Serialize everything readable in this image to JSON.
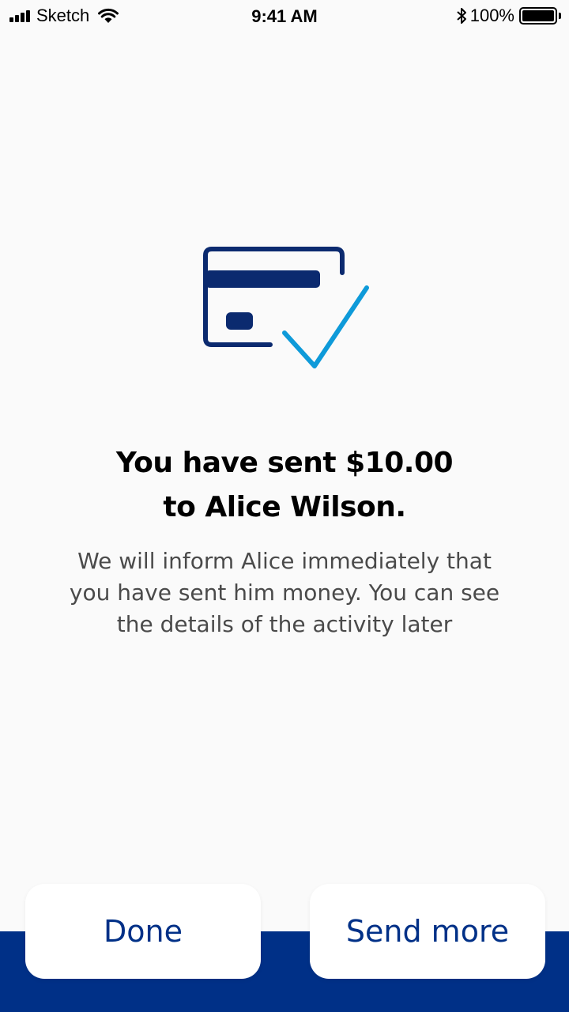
{
  "status_bar": {
    "carrier": "Sketch",
    "time": "9:41 AM",
    "battery_percent": "100%",
    "icons": [
      "signal-icon",
      "wifi-icon",
      "bluetooth-icon",
      "battery-icon"
    ]
  },
  "illustration": {
    "icon": "card-check-icon",
    "colors": {
      "card": "#0b2a6f",
      "check": "#0e9ad9"
    }
  },
  "confirmation": {
    "title_line1": "You have sent $10.00",
    "title_line2": "to Alice Wilson.",
    "message_line1": "We will inform Alice immediately that",
    "message_line2": "you have sent him money. You can see",
    "message_line3": "the details of the activity later"
  },
  "actions": {
    "done_label": "Done",
    "send_more_label": "Send more"
  },
  "colors": {
    "primary": "#003087",
    "background": "#fafafa",
    "button_bg": "#ffffff"
  }
}
